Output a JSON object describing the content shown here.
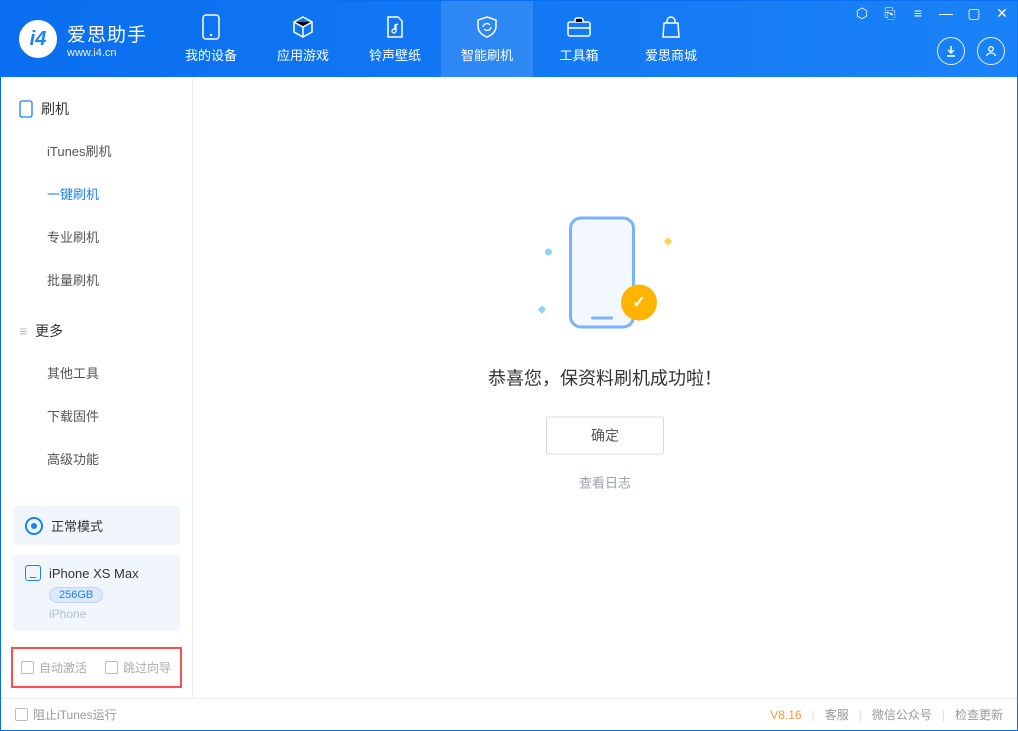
{
  "app": {
    "name_cn": "爱思助手",
    "name_en": "www.i4.cn"
  },
  "header_tabs": [
    {
      "label": "我的设备"
    },
    {
      "label": "应用游戏"
    },
    {
      "label": "铃声壁纸"
    },
    {
      "label": "智能刷机"
    },
    {
      "label": "工具箱"
    },
    {
      "label": "爱思商城"
    }
  ],
  "sidebar": {
    "group1_title": "刷机",
    "group1_items": [
      "iTunes刷机",
      "一键刷机",
      "专业刷机",
      "批量刷机"
    ],
    "group2_title": "更多",
    "group2_items": [
      "其他工具",
      "下载固件",
      "高级功能"
    ],
    "mode_label": "正常模式",
    "device_name": "iPhone XS Max",
    "device_chip": "256GB",
    "device_sub": "iPhone",
    "check_autoactivate": "自动激活",
    "check_skipwizard": "跳过向导"
  },
  "main": {
    "success_msg": "恭喜您，保资料刷机成功啦！",
    "ok_button": "确定",
    "view_log": "查看日志"
  },
  "footer": {
    "block_itunes": "阻止iTunes运行",
    "version": "V8.16",
    "link_service": "客服",
    "link_wechat": "微信公众号",
    "link_update": "检查更新"
  }
}
